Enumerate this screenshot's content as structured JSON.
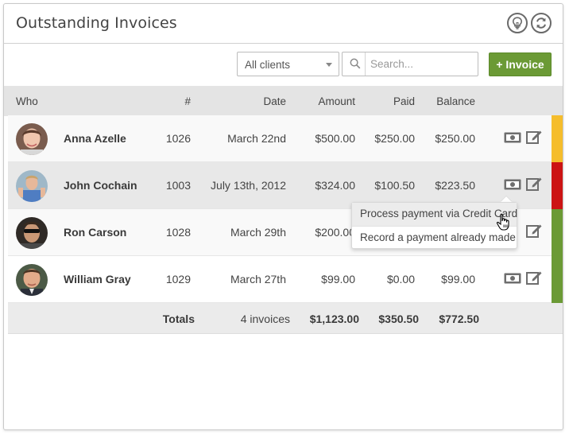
{
  "header": {
    "title": "Outstanding Invoices"
  },
  "toolbar": {
    "client_filter": "All clients",
    "search_placeholder": "Search...",
    "add_label": "+ Invoice"
  },
  "table": {
    "columns": {
      "who": "Who",
      "num": "#",
      "date": "Date",
      "amount": "Amount",
      "paid": "Paid",
      "balance": "Balance"
    },
    "rows": [
      {
        "name": "Anna Azelle",
        "num": "1026",
        "date": "March 22nd",
        "amount": "$500.00",
        "paid": "$250.00",
        "balance": "$250.00",
        "status_color": "#f5bd2c"
      },
      {
        "name": "John Cochain",
        "num": "1003",
        "date": "July 13th, 2012",
        "amount": "$324.00",
        "paid": "$100.50",
        "balance": "$223.50",
        "status_color": "#cc1414"
      },
      {
        "name": "Ron Carson",
        "num": "1028",
        "date": "March 29th",
        "amount": "$200.00",
        "paid": "",
        "balance": "",
        "status_color": "#6b9a35"
      },
      {
        "name": "William Gray",
        "num": "1029",
        "date": "March 27th",
        "amount": "$99.00",
        "paid": "$0.00",
        "balance": "$99.00",
        "status_color": "#6b9a35"
      }
    ],
    "totals": {
      "label": "Totals",
      "count": "4 invoices",
      "amount": "$1,123.00",
      "paid": "$350.50",
      "balance": "$772.50"
    }
  },
  "payment_menu": {
    "items": [
      "Process payment via Credit Card",
      "Record a payment already made"
    ]
  },
  "colors": {
    "accent": "#6b9a35",
    "warning": "#f5bd2c",
    "danger": "#cc1414"
  }
}
